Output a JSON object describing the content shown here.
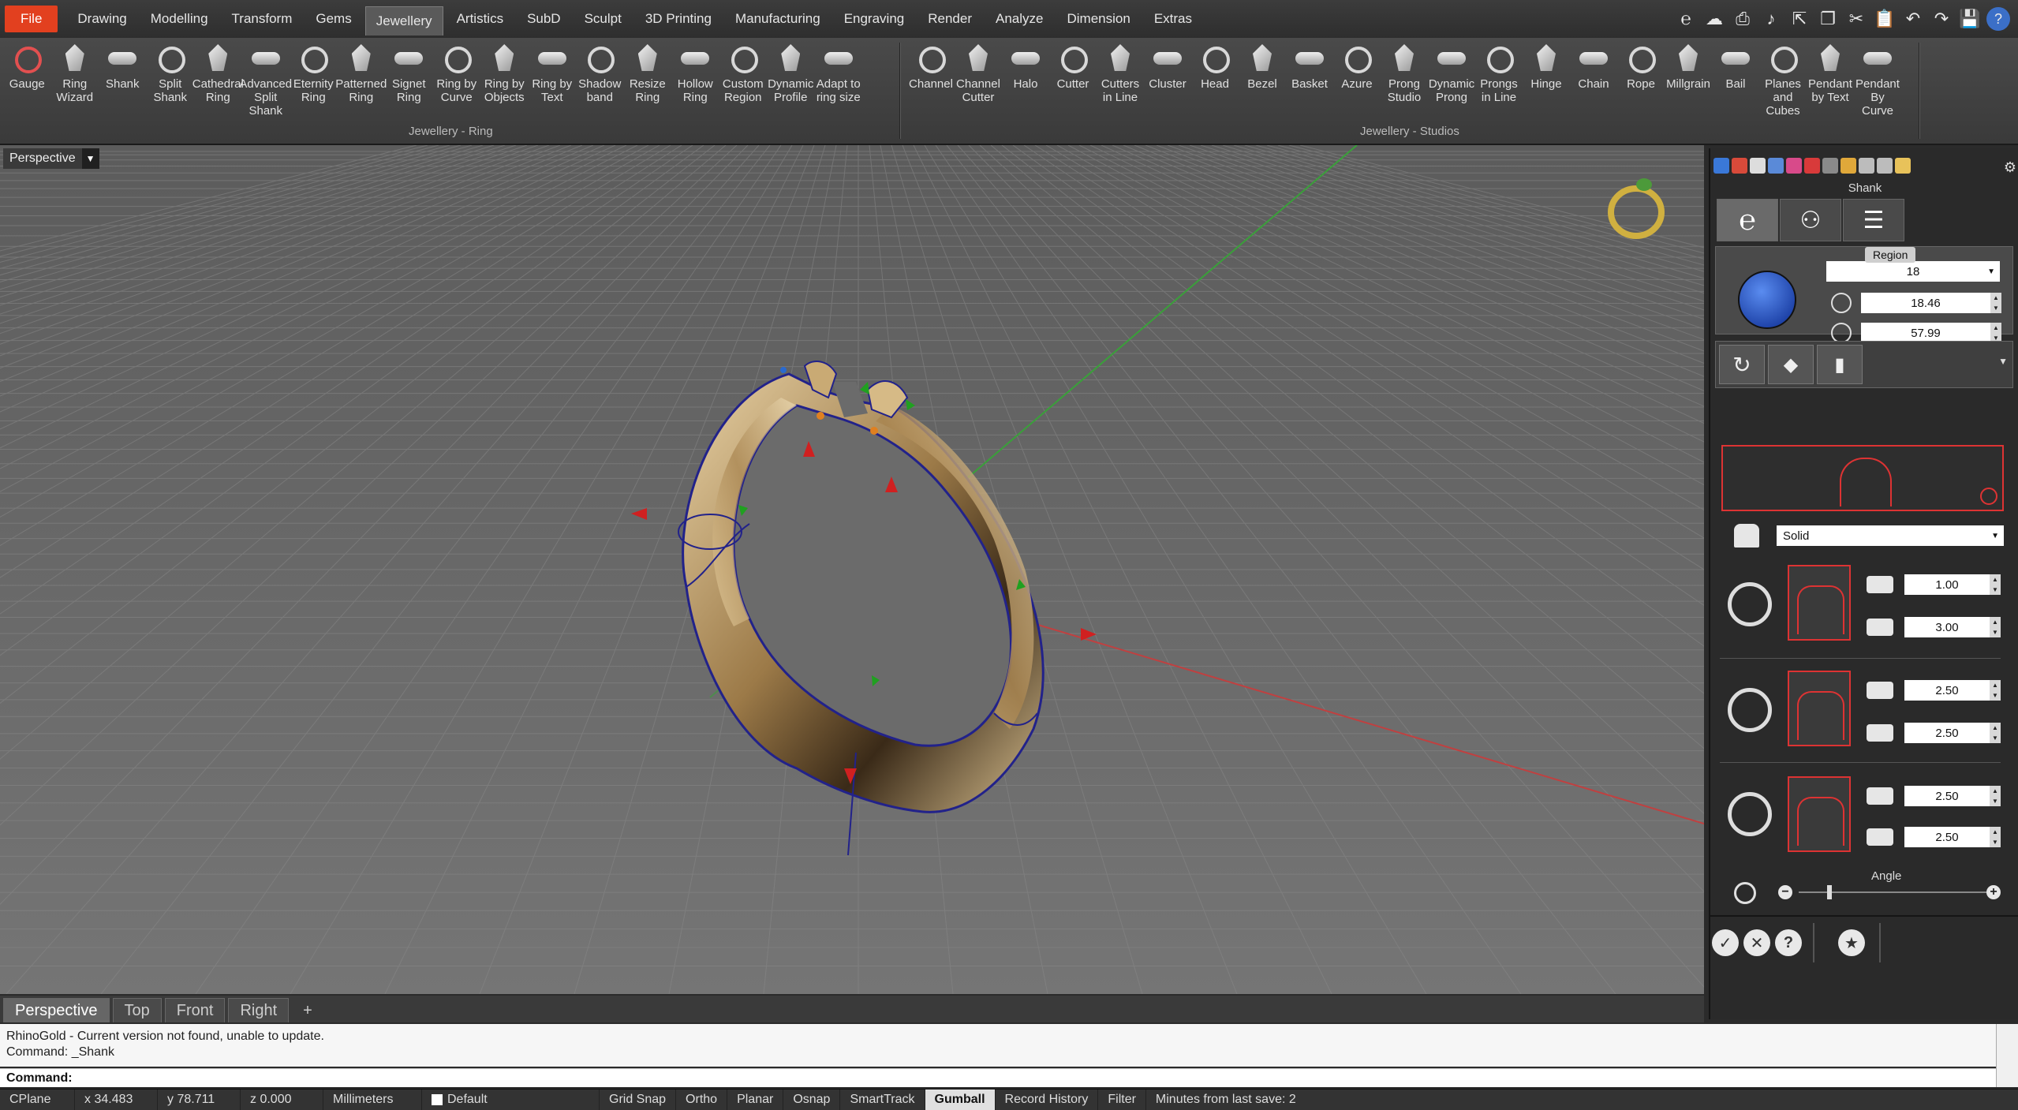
{
  "menu": {
    "file": "File",
    "items": [
      "Drawing",
      "Modelling",
      "Transform",
      "Gems",
      "Jewellery",
      "Artistics",
      "SubD",
      "Sculpt",
      "3D Printing",
      "Manufacturing",
      "Engraving",
      "Render",
      "Analyze",
      "Dimension",
      "Extras"
    ],
    "active": "Jewellery"
  },
  "ribbon": {
    "ring_group_label": "Jewellery - Ring",
    "studios_group_label": "Jewellery - Studios",
    "ring_tools": [
      {
        "label": "Gauge",
        "icon": "gauge-icon"
      },
      {
        "label": "Ring\nWizard",
        "icon": "ring-wizard-icon"
      },
      {
        "label": "Shank",
        "icon": "shank-icon"
      },
      {
        "label": "Split\nShank",
        "icon": "split-shank-icon"
      },
      {
        "label": "Cathedral\nRing",
        "icon": "cathedral-ring-icon"
      },
      {
        "label": "Advanced\nSplit Shank",
        "icon": "advanced-split-shank-icon"
      },
      {
        "label": "Eternity\nRing",
        "icon": "eternity-ring-icon"
      },
      {
        "label": "Patterned\nRing",
        "icon": "patterned-ring-icon"
      },
      {
        "label": "Signet\nRing",
        "icon": "signet-ring-icon"
      },
      {
        "label": "Ring by\nCurve",
        "icon": "ring-by-curve-icon"
      },
      {
        "label": "Ring by\nObjects",
        "icon": "ring-by-objects-icon"
      },
      {
        "label": "Ring by\nText",
        "icon": "ring-by-text-icon"
      },
      {
        "label": "Shadow\nband",
        "icon": "shadow-band-icon"
      },
      {
        "label": "Resize\nRing",
        "icon": "resize-ring-icon"
      },
      {
        "label": "Hollow\nRing",
        "icon": "hollow-ring-icon"
      },
      {
        "label": "Custom\nRegion",
        "icon": "custom-region-icon"
      },
      {
        "label": "Dynamic\nProfile",
        "icon": "dynamic-profile-icon"
      },
      {
        "label": "Adapt to\nring size",
        "icon": "adapt-ring-size-icon"
      }
    ],
    "studio_tools": [
      {
        "label": "Channel",
        "icon": "channel-icon"
      },
      {
        "label": "Channel\nCutter",
        "icon": "channel-cutter-icon"
      },
      {
        "label": "Halo",
        "icon": "halo-icon"
      },
      {
        "label": "Cutter",
        "icon": "cutter-icon"
      },
      {
        "label": "Cutters\nin Line",
        "icon": "cutters-in-line-icon"
      },
      {
        "label": "Cluster",
        "icon": "cluster-icon"
      },
      {
        "label": "Head",
        "icon": "head-icon"
      },
      {
        "label": "Bezel",
        "icon": "bezel-icon"
      },
      {
        "label": "Basket",
        "icon": "basket-icon"
      },
      {
        "label": "Azure",
        "icon": "azure-icon"
      },
      {
        "label": "Prong\nStudio",
        "icon": "prong-studio-icon"
      },
      {
        "label": "Dynamic\nProng",
        "icon": "dynamic-prong-icon"
      },
      {
        "label": "Prongs\nin Line",
        "icon": "prongs-in-line-icon"
      },
      {
        "label": "Hinge",
        "icon": "hinge-icon"
      },
      {
        "label": "Chain",
        "icon": "chain-icon"
      },
      {
        "label": "Rope",
        "icon": "rope-icon"
      },
      {
        "label": "Millgrain",
        "icon": "millgrain-icon"
      },
      {
        "label": "Bail",
        "icon": "bail-icon"
      },
      {
        "label": "Planes and\nCubes",
        "icon": "planes-cubes-icon"
      },
      {
        "label": "Pendant\nby Text",
        "icon": "pendant-by-text-icon"
      },
      {
        "label": "Pendant\nBy Curve",
        "icon": "pendant-by-curve-icon"
      }
    ]
  },
  "viewport": {
    "label": "Perspective",
    "tabs": [
      "Perspective",
      "Top",
      "Front",
      "Right"
    ],
    "active_tab": "Perspective"
  },
  "panel": {
    "title": "Shank",
    "region_label": "Region",
    "ring_size": "18",
    "diameter": "18.46",
    "circumference": "57.99",
    "profile_type": "Solid",
    "profiles": [
      {
        "width": "1.00",
        "height": "3.00"
      },
      {
        "width": "2.50",
        "height": "2.50"
      },
      {
        "width": "2.50",
        "height": "2.50"
      }
    ],
    "angle_label": "Angle"
  },
  "command": {
    "history_1": "RhinoGold - Current version not found, unable to update.",
    "history_2": "Command: _Shank",
    "prompt": "Command:"
  },
  "status": {
    "cplane": "CPlane",
    "x": "x 34.483",
    "y": "y 78.711",
    "z": "z 0.000",
    "units": "Millimeters",
    "layer": "Default",
    "toggles": [
      "Grid Snap",
      "Ortho",
      "Planar",
      "Osnap",
      "SmartTrack",
      "Gumball",
      "Record History",
      "Filter"
    ],
    "active_toggle": "Gumball",
    "save_info": "Minutes from last save: 2"
  },
  "colors": {
    "file_button": "#e2401f",
    "viewport_bg": "#6b6b6b",
    "x_axis": "#c03030",
    "y_axis": "#30a030",
    "gumball_x": "#d02020",
    "gumball_y": "#20a020",
    "ring_gold": "#b89a6a",
    "profile_red": "#dd3333"
  }
}
